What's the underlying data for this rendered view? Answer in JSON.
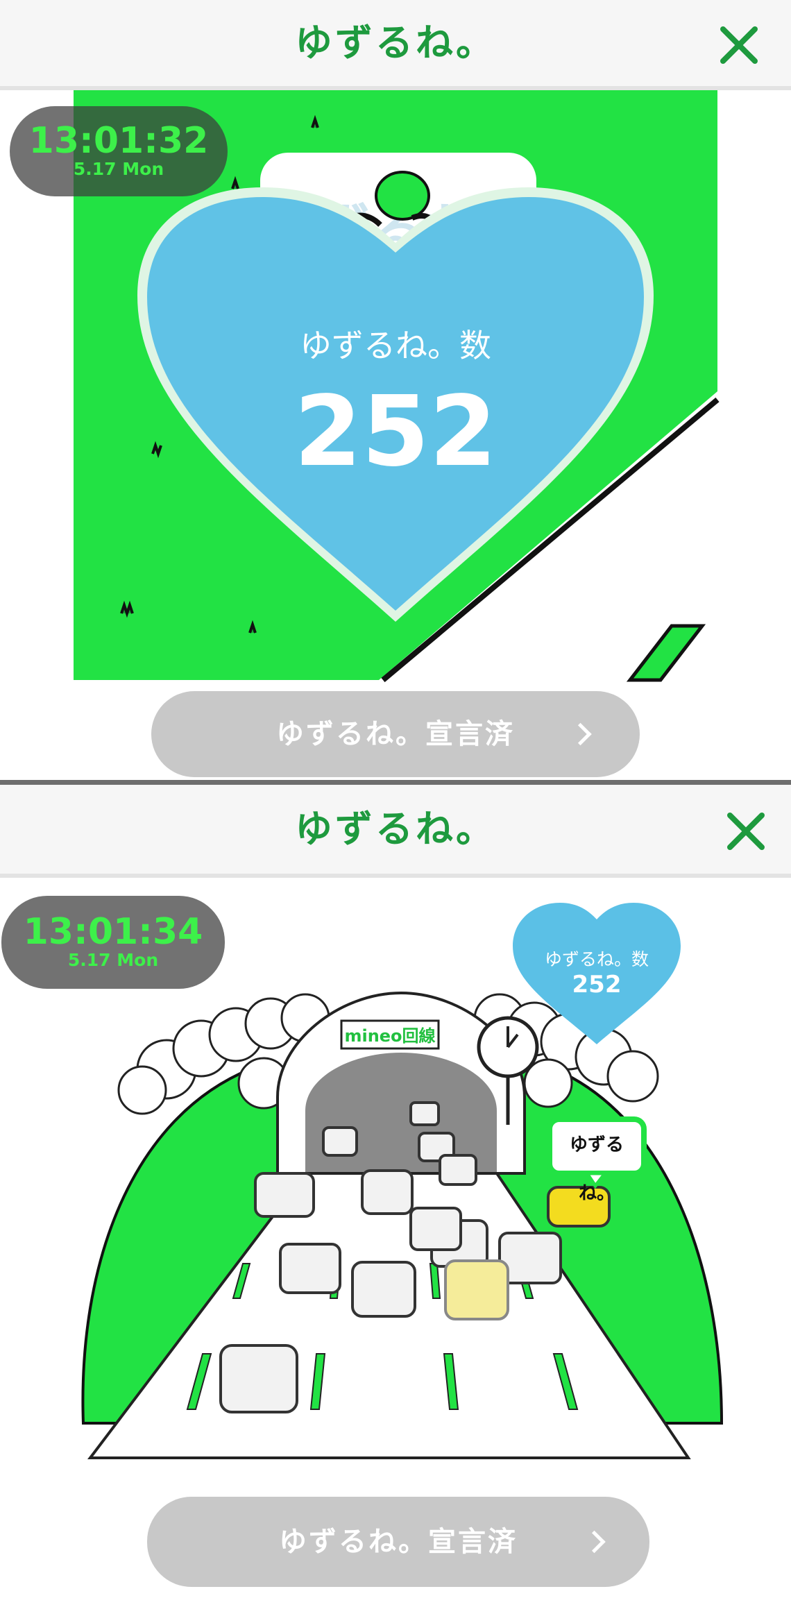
{
  "screens": [
    {
      "header": {
        "title": "ゆずるね。"
      },
      "clock": {
        "time": "13:01:32",
        "date": "5.17 Mon"
      },
      "counter": {
        "label": "ゆずるね。数",
        "value": "252"
      },
      "badge_text": "ゆずるね。",
      "cta": {
        "label": "ゆずるね。宣言済"
      }
    },
    {
      "header": {
        "title": "ゆずるね。"
      },
      "clock": {
        "time": "13:01:34",
        "date": "5.17 Mon"
      },
      "counter": {
        "label": "ゆずるね。数",
        "value": "252"
      },
      "sign_text": "mineo回線",
      "bubble_text": "ゆずるね。",
      "cta": {
        "label": "ゆずるね。宣言済"
      }
    }
  ],
  "colors": {
    "brand_green": "#1e9a3e",
    "grass_green": "#22e244",
    "heart_blue": "#5bc0e6",
    "clock_green": "#3df04a",
    "button_gray": "#c8c8c8"
  },
  "icons": [
    "close-icon",
    "chevron-right-icon",
    "heart-icon",
    "clock-icon"
  ]
}
